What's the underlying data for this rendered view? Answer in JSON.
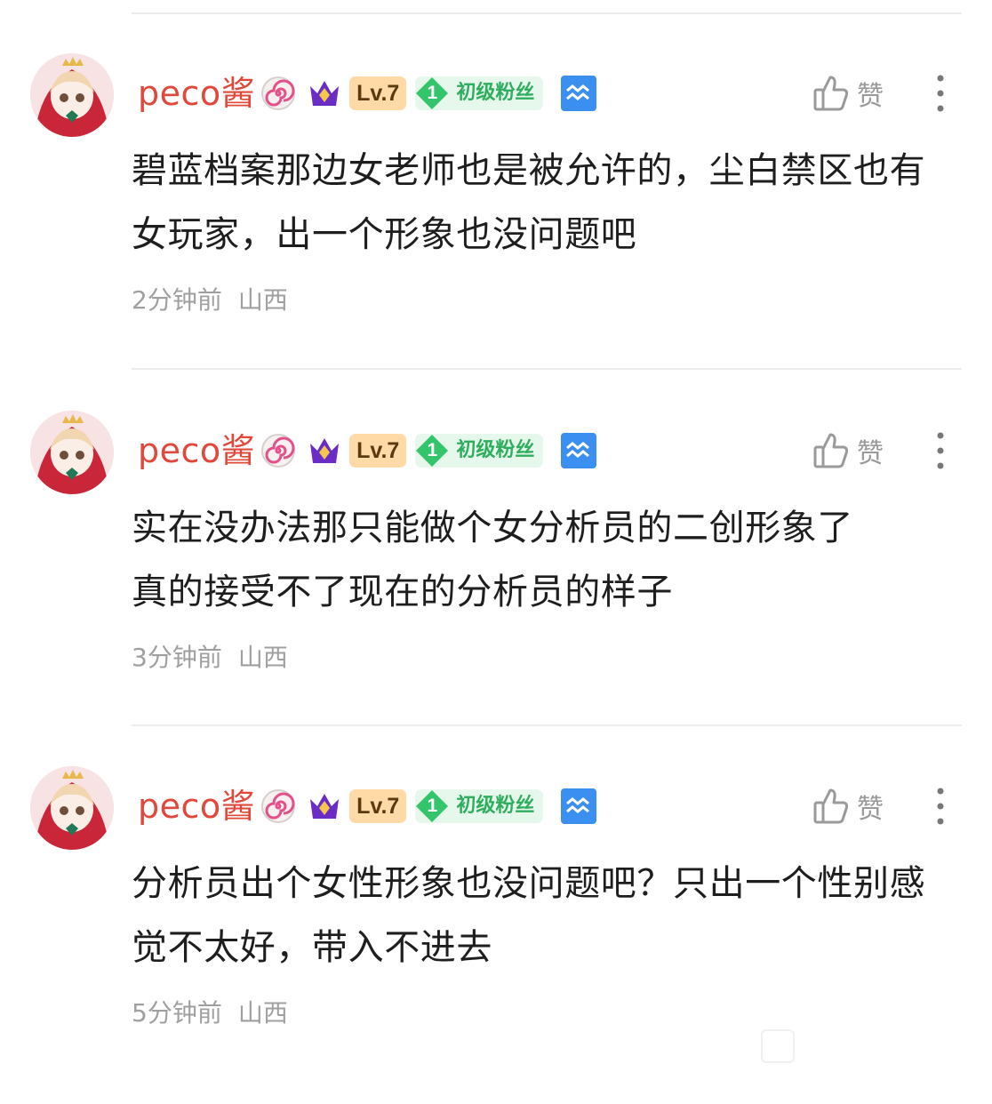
{
  "comments": [
    {
      "username": "peco酱",
      "level": "Lv.7",
      "fan_level": "1",
      "fan_label": "初级粉丝",
      "like_label": "赞",
      "text": "碧蓝档案那边女老师也是被允许的，尘白禁区也有女玩家，出一个形象也没问题吧",
      "time": "2分钟前",
      "location": "山西"
    },
    {
      "username": "peco酱",
      "level": "Lv.7",
      "fan_level": "1",
      "fan_label": "初级粉丝",
      "like_label": "赞",
      "text": "实在没办法那只能做个女分析员的二创形象了\n真的接受不了现在的分析员的样子",
      "time": "3分钟前",
      "location": "山西"
    },
    {
      "username": "peco酱",
      "level": "Lv.7",
      "fan_level": "1",
      "fan_label": "初级粉丝",
      "like_label": "赞",
      "text": "分析员出个女性形象也没问题吧？只出一个性别感觉不太好，带入不进去",
      "time": "5分钟前",
      "location": "山西"
    }
  ],
  "icons": {
    "avatar": "avatar-anime-girl",
    "swirl_badge": "lollipop-swirl-icon",
    "crown_badge": "purple-crown-icon",
    "fan_badge": "green-diamond-icon",
    "zodiac": "aquarius-icon",
    "like": "thumbs-up-icon",
    "more": "vertical-ellipsis-icon"
  },
  "colors": {
    "username": "#e0483c",
    "level_bg": "#ffd9a6",
    "fan_bg": "#e6f7ec",
    "fan_text": "#2fae5f",
    "zodiac_bg": "#3b8ff0",
    "meta": "#a0a0a0"
  }
}
